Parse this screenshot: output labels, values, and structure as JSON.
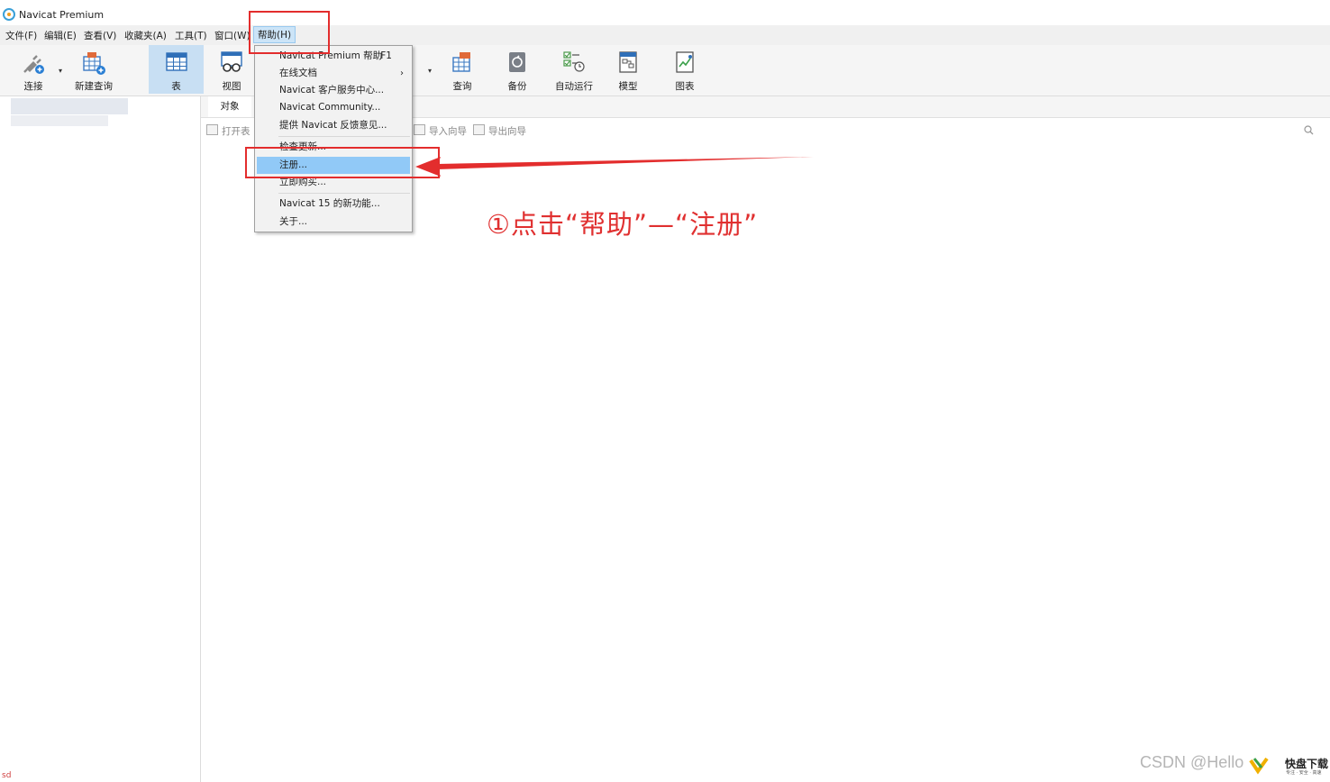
{
  "window": {
    "title": "Navicat Premium"
  },
  "menubar": {
    "items": [
      {
        "label": "文件(F)"
      },
      {
        "label": "编辑(E)"
      },
      {
        "label": "查看(V)"
      },
      {
        "label": "收藏夹(A)"
      },
      {
        "label": "工具(T)"
      },
      {
        "label": "窗口(W)"
      },
      {
        "label": "帮助(H)",
        "active": true
      }
    ]
  },
  "toolbar": {
    "items": [
      {
        "label": "连接",
        "icon": "plug-icon"
      },
      {
        "label": "新建查询",
        "icon": "new-query-icon"
      },
      {
        "label": "表",
        "icon": "table-icon",
        "selected": true
      },
      {
        "label": "视图",
        "icon": "view-icon"
      },
      {
        "label": "查询",
        "icon": "query-icon"
      },
      {
        "label": "备份",
        "icon": "backup-icon"
      },
      {
        "label": "自动运行",
        "icon": "automation-icon"
      },
      {
        "label": "模型",
        "icon": "model-icon"
      },
      {
        "label": "图表",
        "icon": "chart-icon"
      }
    ]
  },
  "object_tabs": {
    "active": "对象"
  },
  "object_toolbar": {
    "open_table": "打开表",
    "import_wizard": "导入向导",
    "export_wizard": "导出向导"
  },
  "help_menu": {
    "items": [
      {
        "label": "Navicat Premium 帮助",
        "shortcut": "F1"
      },
      {
        "label": "在线文档",
        "submenu": true
      },
      {
        "label": "Navicat 客户服务中心..."
      },
      {
        "label": "Navicat Community..."
      },
      {
        "label": "提供 Navicat 反馈意见..."
      },
      {
        "label": "检查更新..."
      },
      {
        "label": "注册...",
        "highlighted": true
      },
      {
        "label": "立即购买..."
      },
      {
        "label": "Navicat 15 的新功能..."
      },
      {
        "label": "关于..."
      }
    ],
    "submenu_arrow": "›"
  },
  "annotation": {
    "text": "①点击“帮助”—“注册”",
    "color": "#e32d2d"
  },
  "watermark": {
    "csdn": "CSDN @Hello",
    "logo": "快盘下载",
    "logo_sub": "专注 · 安全 · 高速",
    "corner": "sd"
  },
  "colors": {
    "accent": "#91c9f7",
    "selected_tool": "#c8dff3",
    "annotation_red": "#e32d2d"
  }
}
